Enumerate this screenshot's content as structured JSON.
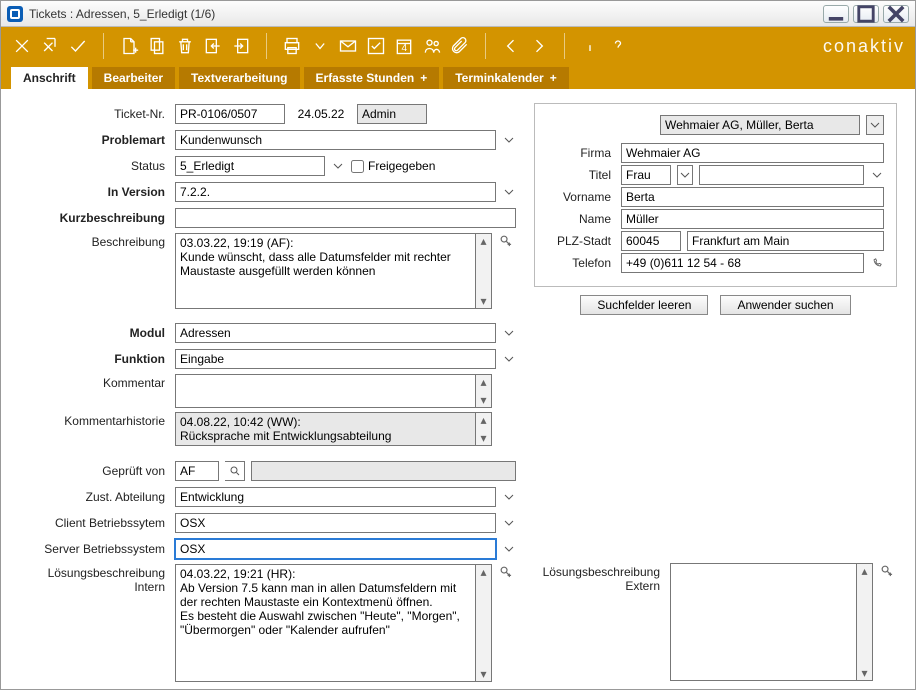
{
  "window": {
    "title": "Tickets : Adressen, 5_Erledigt (1/6)"
  },
  "tabs": {
    "anschrift": "Anschrift",
    "bearbeiter": "Bearbeiter",
    "textverarbeitung": "Textverarbeitung",
    "erfasste": "Erfasste Stunden",
    "terminkalender": "Terminkalender"
  },
  "labels": {
    "ticketnr": "Ticket-Nr.",
    "problemart": "Problemart",
    "status": "Status",
    "freigegeben": "Freigegeben",
    "inversion": "In Version",
    "kurzbeschreibung": "Kurzbeschreibung",
    "beschreibung": "Beschreibung",
    "modul": "Modul",
    "funktion": "Funktion",
    "kommentar": "Kommentar",
    "kommentarhistorie": "Kommentarhistorie",
    "geprueft_von": "Geprüft von",
    "zust_abteilung": "Zust. Abteilung",
    "client_os": "Client Betriebssytem",
    "server_os": "Server Betriebssystem",
    "loesung_intern_1": "Lösungsbeschreibung",
    "loesung_intern_2": "Intern",
    "loesung_extern_1": "Lösungsbeschreibung",
    "loesung_extern_2": "Extern",
    "firma": "Firma",
    "titel": "Titel",
    "vorname": "Vorname",
    "name": "Name",
    "plz_stadt": "PLZ-Stadt",
    "telefon": "Telefon"
  },
  "fields": {
    "ticketnr": "PR-0106/0507",
    "date": "24.05.22",
    "user": "Admin",
    "problemart": "Kundenwunsch",
    "status": "5_Erledigt",
    "inversion": "7.2.2.",
    "kurzbeschreibung": "",
    "beschreibung": "03.03.22, 19:19 (AF):\nKunde wünscht, dass alle Datumsfelder mit rechter Maustaste ausgefüllt werden können",
    "modul": "Adressen",
    "funktion": "Eingabe",
    "kommentar": "",
    "kommentarhistorie": "04.08.22, 10:42 (WW):\nRücksprache mit Entwicklungsabteilung",
    "geprueft_von": "AF",
    "zust_abteilung": "Entwicklung",
    "client_os": "OSX",
    "server_os": "OSX",
    "loesung_intern": "04.03.22, 19:21 (HR):\nAb Version 7.5 kann man in allen Datumsfeldern mit der rechten Maustaste ein Kontextmenü öffnen.\nEs besteht die Auswahl zwischen \"Heute\", \"Morgen\", \"Übermorgen\" oder \"Kalender aufrufen\"",
    "loesung_extern": ""
  },
  "contact": {
    "selector": "Wehmaier AG, Müller, Berta",
    "firma": "Wehmaier AG",
    "titel": "Frau",
    "vorname": "Berta",
    "name": "Müller",
    "plz": "60045",
    "stadt": "Frankfurt am Main",
    "telefon": "+49 (0)611 12 54 - 68"
  },
  "buttons": {
    "suchfelder_leeren": "Suchfelder leeren",
    "anwender_suchen": "Anwender suchen"
  },
  "brand": "conaktiv"
}
